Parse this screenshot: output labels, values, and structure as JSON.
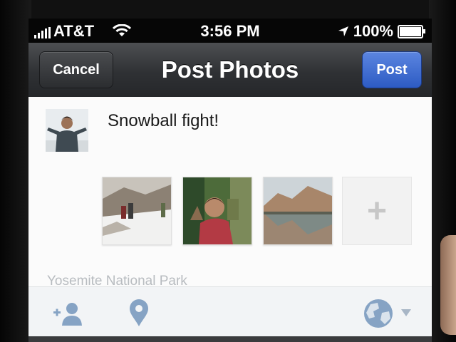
{
  "status_bar": {
    "carrier": "AT&T",
    "time": "3:56 PM",
    "battery": "100%"
  },
  "nav": {
    "title": "Post Photos",
    "cancel_label": "Cancel",
    "post_label": "Post"
  },
  "composer": {
    "status_text": "Snowball fight!",
    "location": "Yosemite National Park",
    "add_photo_label": "+"
  },
  "colors": {
    "post_button": "#2d5bc3",
    "nav_bar": "#2f3134"
  },
  "icons": {
    "tag_friends": "add-person-icon",
    "location": "location-pin-icon",
    "audience": "globe-icon",
    "dropdown": "chevron-down-icon"
  }
}
